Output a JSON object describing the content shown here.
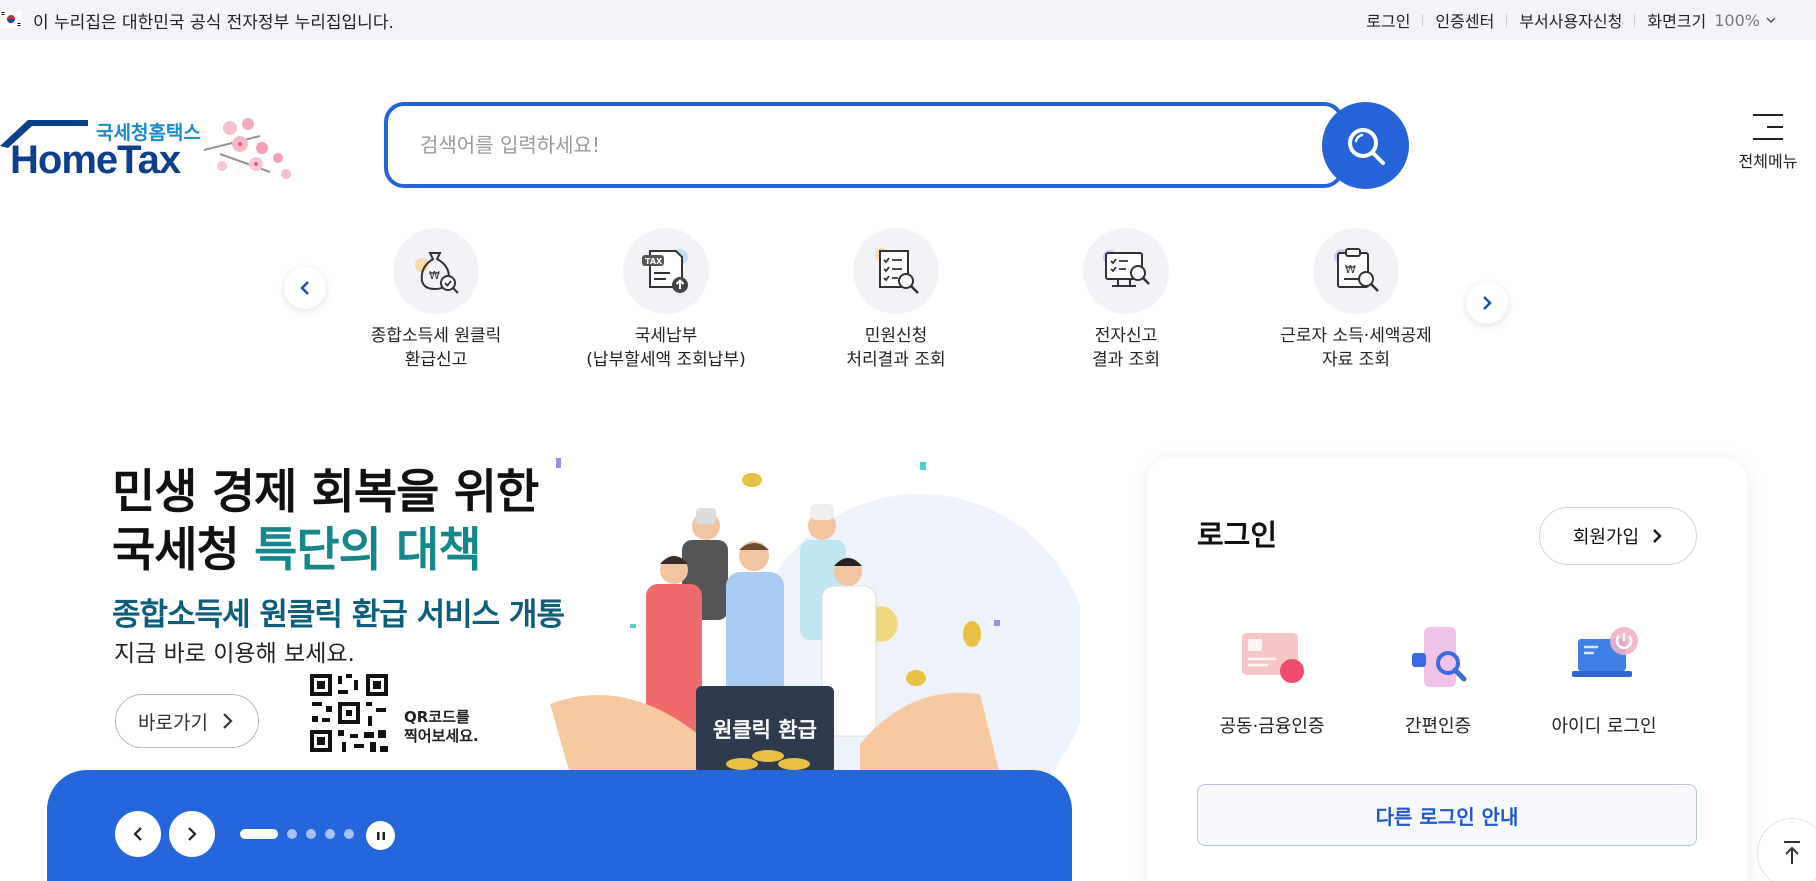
{
  "govbar": {
    "notice": "이 누리집은 대한민국 공식 전자정부 누리집입니다.",
    "links": [
      "로그인",
      "인증센터",
      "부서사용자신청"
    ],
    "zoom_label": "화면크기",
    "zoom_value": "100%"
  },
  "header": {
    "logo_sub": "국세청홈택스",
    "logo_main": "HomeTax",
    "search_placeholder": "검색어를 입력하세요!",
    "all_menu": "전체메뉴"
  },
  "quick_menu": [
    {
      "line1": "종합소득세 원클릭",
      "line2": "환급신고",
      "icon": "money-bag-search-icon"
    },
    {
      "line1": "국세납부",
      "line2": "(납부할세액 조회납부)",
      "icon": "tax-document-upload-icon"
    },
    {
      "line1": "민원신청",
      "line2": "처리결과 조회",
      "icon": "checklist-search-icon"
    },
    {
      "line1": "전자신고",
      "line2": "결과 조회",
      "icon": "monitor-search-icon"
    },
    {
      "line1": "근로자 소득·세액공제",
      "line2": "자료 조회",
      "icon": "clipboard-won-search-icon"
    }
  ],
  "hero": {
    "title_line1": "민생 경제 회복을 위한",
    "title_line2_a": "국세청 ",
    "title_line2_b": "특단의 대책",
    "subtitle": "종합소득세 원클릭 환급 서비스 개통",
    "desc": "지금 바로 이용해 보세요.",
    "go_button": "바로가기",
    "qr_line1": "QR코드를",
    "qr_line2": "찍어보세요.",
    "sign_text": "원클릭 환급"
  },
  "slider": {
    "total_dots": 5,
    "active_index": 0
  },
  "login": {
    "title": "로그인",
    "join": "회원가입",
    "options": [
      {
        "label": "공동·금융인증",
        "icon": "certificate-card-icon"
      },
      {
        "label": "간편인증",
        "icon": "phone-search-icon"
      },
      {
        "label": "아이디 로그인",
        "icon": "laptop-power-icon"
      }
    ],
    "other": "다른 로그인 안내"
  },
  "colors": {
    "primary": "#2563d9",
    "teal": "#16868d",
    "band": "#2566dd"
  }
}
